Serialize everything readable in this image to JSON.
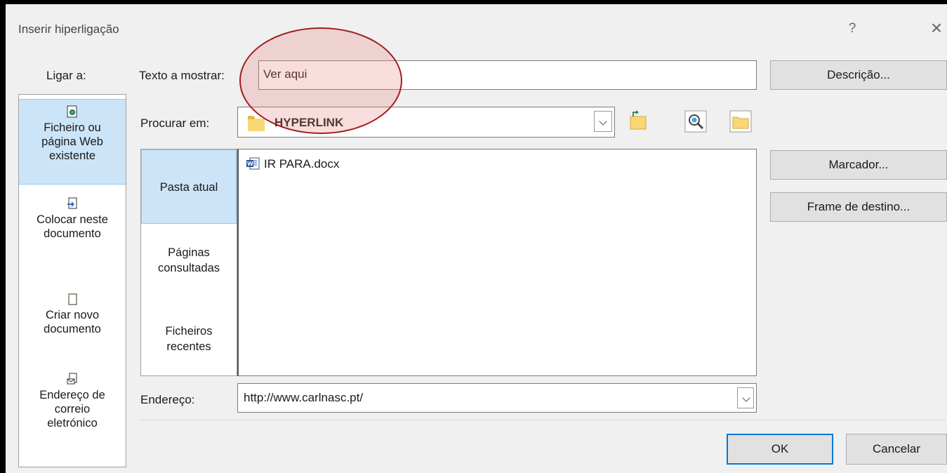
{
  "dialog": {
    "title": "Inserir hiperligação",
    "help": "?",
    "close": "×"
  },
  "link_to": {
    "label": "Ligar a:",
    "items": [
      {
        "line1": "Ficheiro ou",
        "line2": "página Web",
        "line3": "existente",
        "icon": "web-page-icon"
      },
      {
        "line1": "Colocar neste",
        "line2": "documento",
        "icon": "document-place-icon"
      },
      {
        "line1": "Criar novo",
        "line2": "documento",
        "icon": "new-document-icon"
      },
      {
        "line1": "Endereço de",
        "line2": "correio",
        "line3": "eletrónico",
        "icon": "email-icon"
      }
    ]
  },
  "text_to_display": {
    "label": "Texto a mostrar:",
    "value": "Ver aqui"
  },
  "look_in": {
    "label": "Procurar em:",
    "value": "HYPERLINK"
  },
  "side_tabs": [
    {
      "line1": "Pasta atual"
    },
    {
      "line1": "Páginas",
      "line2": "consultadas"
    },
    {
      "line1": "Ficheiros",
      "line2": "recentes"
    }
  ],
  "files": [
    {
      "name": "IR PARA.docx",
      "icon": "word-doc-icon"
    }
  ],
  "address": {
    "label": "Endereço:",
    "value": "http://www.carlnasc.pt/"
  },
  "buttons": {
    "description": "Descrição...",
    "bookmark": "Marcador...",
    "target_frame": "Frame de destino...",
    "ok": "OK",
    "cancel": "Cancelar"
  },
  "colors": {
    "selected_bg": "#cce4f7",
    "default_button_border": "#0078d7",
    "annotation": "#a01f1f"
  }
}
